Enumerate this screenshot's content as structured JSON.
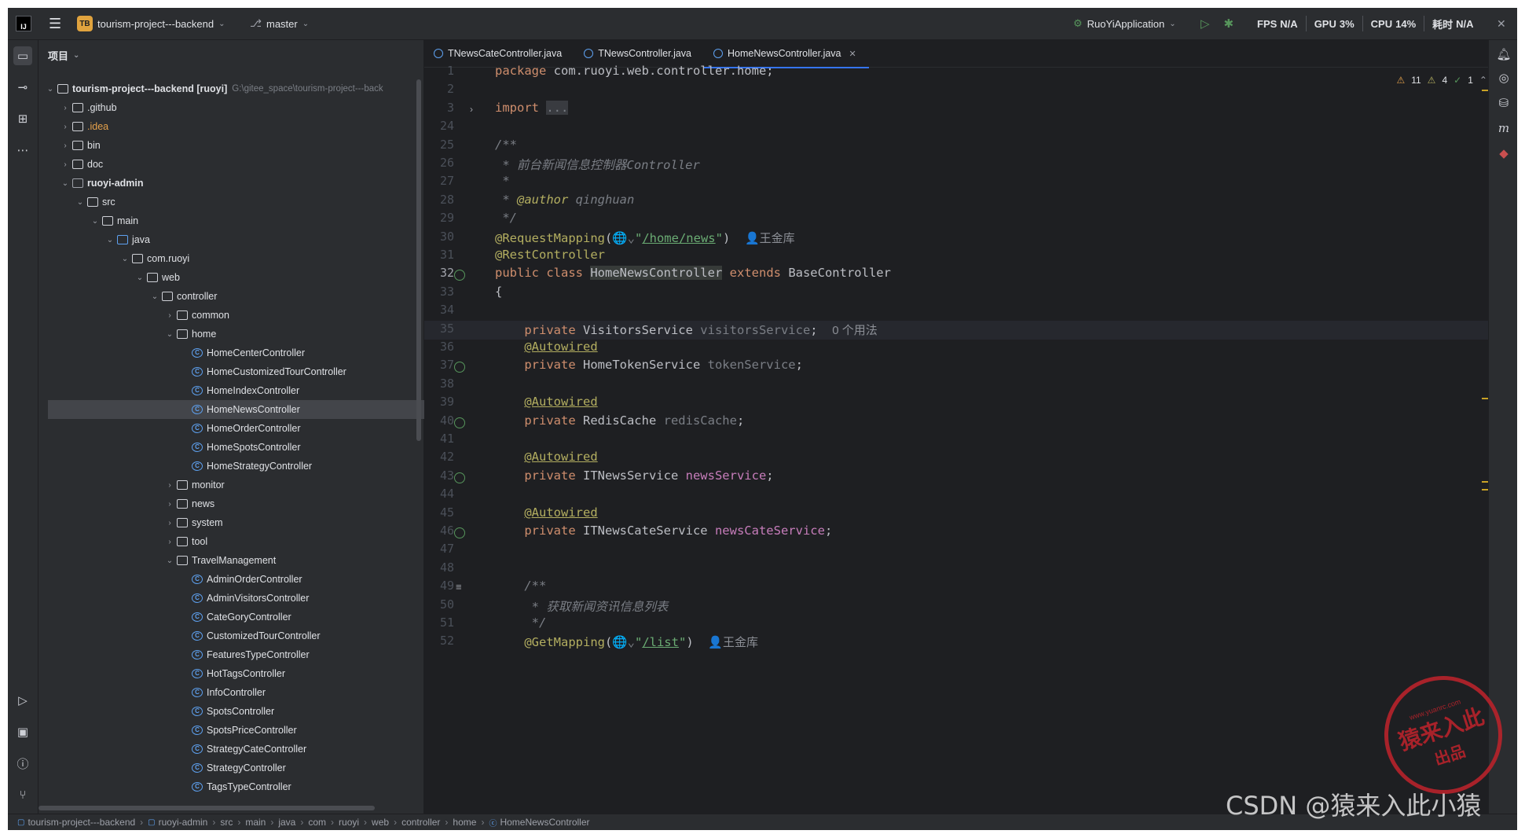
{
  "title_bar": {
    "project_badge": "TB",
    "project_name": "tourism-project---backend",
    "branch": "master",
    "run_config": "RuoYiApplication",
    "fps_label": "FPS",
    "fps_value": "N/A",
    "gpu_label": "GPU",
    "gpu_value": "3%",
    "cpu_label": "CPU",
    "cpu_value": "14%",
    "time_label": "耗时",
    "time_value": "N/A"
  },
  "project_panel": {
    "title": "项目",
    "tree": [
      {
        "label": "tourism-project---backend [ruoyi]",
        "path": "G:\\gitee_space\\tourism-project---back",
        "indent": 0,
        "arrow": "⌄",
        "icon": "folder",
        "bold": true
      },
      {
        "label": ".github",
        "indent": 1,
        "arrow": "›",
        "icon": "folder"
      },
      {
        "label": ".idea",
        "indent": 1,
        "arrow": "›",
        "icon": "folder",
        "color": "orange"
      },
      {
        "label": "bin",
        "indent": 1,
        "arrow": "›",
        "icon": "folder"
      },
      {
        "label": "doc",
        "indent": 1,
        "arrow": "›",
        "icon": "folder"
      },
      {
        "label": "ruoyi-admin",
        "indent": 1,
        "arrow": "⌄",
        "icon": "folder-mod",
        "bold": true
      },
      {
        "label": "src",
        "indent": 2,
        "arrow": "⌄",
        "icon": "folder"
      },
      {
        "label": "main",
        "indent": 3,
        "arrow": "⌄",
        "icon": "folder"
      },
      {
        "label": "java",
        "indent": 4,
        "arrow": "⌄",
        "icon": "folder-blue"
      },
      {
        "label": "com.ruoyi",
        "indent": 5,
        "arrow": "⌄",
        "icon": "package"
      },
      {
        "label": "web",
        "indent": 6,
        "arrow": "⌄",
        "icon": "package"
      },
      {
        "label": "controller",
        "indent": 7,
        "arrow": "⌄",
        "icon": "package"
      },
      {
        "label": "common",
        "indent": 8,
        "arrow": "›",
        "icon": "package"
      },
      {
        "label": "home",
        "indent": 8,
        "arrow": "⌄",
        "icon": "package"
      },
      {
        "label": "HomeCenterController",
        "indent": 9,
        "arrow": "",
        "icon": "class"
      },
      {
        "label": "HomeCustomizedTourController",
        "indent": 9,
        "arrow": "",
        "icon": "class"
      },
      {
        "label": "HomeIndexController",
        "indent": 9,
        "arrow": "",
        "icon": "class"
      },
      {
        "label": "HomeNewsController",
        "indent": 9,
        "arrow": "",
        "icon": "class",
        "selected": true
      },
      {
        "label": "HomeOrderController",
        "indent": 9,
        "arrow": "",
        "icon": "class"
      },
      {
        "label": "HomeSpotsController",
        "indent": 9,
        "arrow": "",
        "icon": "class"
      },
      {
        "label": "HomeStrategyController",
        "indent": 9,
        "arrow": "",
        "icon": "class"
      },
      {
        "label": "monitor",
        "indent": 8,
        "arrow": "›",
        "icon": "package"
      },
      {
        "label": "news",
        "indent": 8,
        "arrow": "›",
        "icon": "package"
      },
      {
        "label": "system",
        "indent": 8,
        "arrow": "›",
        "icon": "package"
      },
      {
        "label": "tool",
        "indent": 8,
        "arrow": "›",
        "icon": "package"
      },
      {
        "label": "TravelManagement",
        "indent": 8,
        "arrow": "⌄",
        "icon": "package"
      },
      {
        "label": "AdminOrderController",
        "indent": 9,
        "arrow": "",
        "icon": "class"
      },
      {
        "label": "AdminVisitorsController",
        "indent": 9,
        "arrow": "",
        "icon": "class"
      },
      {
        "label": "CateGoryController",
        "indent": 9,
        "arrow": "",
        "icon": "class"
      },
      {
        "label": "CustomizedTourController",
        "indent": 9,
        "arrow": "",
        "icon": "class"
      },
      {
        "label": "FeaturesTypeController",
        "indent": 9,
        "arrow": "",
        "icon": "class"
      },
      {
        "label": "HotTagsController",
        "indent": 9,
        "arrow": "",
        "icon": "class"
      },
      {
        "label": "InfoController",
        "indent": 9,
        "arrow": "",
        "icon": "class"
      },
      {
        "label": "SpotsController",
        "indent": 9,
        "arrow": "",
        "icon": "class"
      },
      {
        "label": "SpotsPriceController",
        "indent": 9,
        "arrow": "",
        "icon": "class"
      },
      {
        "label": "StrategyCateController",
        "indent": 9,
        "arrow": "",
        "icon": "class"
      },
      {
        "label": "StrategyController",
        "indent": 9,
        "arrow": "",
        "icon": "class"
      },
      {
        "label": "TagsTypeController",
        "indent": 9,
        "arrow": "",
        "icon": "class"
      }
    ]
  },
  "editor": {
    "tabs": [
      {
        "label": "TNewsCateController.java",
        "active": false
      },
      {
        "label": "TNewsController.java",
        "active": false
      },
      {
        "label": "HomeNewsController.java",
        "active": true
      }
    ],
    "inspections": {
      "warnings": "11",
      "weak_warnings": "4",
      "typos": "1"
    },
    "lines": [
      {
        "n": "1",
        "html": "<span class='kw'>package</span> com.ruoyi.web.controller.home;"
      },
      {
        "n": "2",
        "html": ""
      },
      {
        "n": "3",
        "html": "<span class='kw'>import</span> <span class='gray' style='background:#393b40'>...</span>",
        "fold": true
      },
      {
        "n": "24",
        "html": ""
      },
      {
        "n": "25",
        "html": "<span class='cm'>/**</span>"
      },
      {
        "n": "26",
        "html": "<span class='cm'> * 前台新闻信息控制器Controller</span>"
      },
      {
        "n": "27",
        "html": "<span class='cm'> *</span>"
      },
      {
        "n": "28",
        "html": "<span class='cm'> * <span style='color:#b3ae60;font-style:italic'>@author</span> qinghuan</span>"
      },
      {
        "n": "29",
        "html": "<span class='cm'> */</span>"
      },
      {
        "n": "30",
        "html": "<span class='an'>@RequestMapping</span>(<span class='gray'>🌐⌄</span><span class='str'>\"<u>/home/news</u>\"</span>)  <span class='inlay'>👤王金库</span>"
      },
      {
        "n": "31",
        "html": "<span class='an'>@RestController</span>"
      },
      {
        "n": "32",
        "html": "<span class='kw'>public class</span> <span style='background:#373b39'>HomeNewsController</span> <span class='kw'>extends</span> BaseController",
        "current": true,
        "gicon": true
      },
      {
        "n": "33",
        "html": "{"
      },
      {
        "n": "34",
        "html": ""
      },
      {
        "n": "35",
        "html": "    <span class='kw'>private</span> VisitorsService <span class='gray'>visitorsService</span>;  <span class='inlay'>0 个用法</span>"
      },
      {
        "n": "36",
        "html": "    <span class='an'><u>@Autowired</u></span>"
      },
      {
        "n": "37",
        "html": "    <span class='kw'>private</span> HomeTokenService <span class='gray'>tokenService</span>;",
        "gicon": true
      },
      {
        "n": "38",
        "html": ""
      },
      {
        "n": "39",
        "html": "    <span class='an'><u>@Autowired</u></span>"
      },
      {
        "n": "40",
        "html": "    <span class='kw'>private</span> RedisCache <span class='gray'>redisCache</span>;",
        "gicon": true
      },
      {
        "n": "41",
        "html": ""
      },
      {
        "n": "42",
        "html": "    <span class='an'><u>@Autowired</u></span>"
      },
      {
        "n": "43",
        "html": "    <span class='kw'>private</span> ITNewsService <span class='fld'>newsService</span>;",
        "gicon": true
      },
      {
        "n": "44",
        "html": ""
      },
      {
        "n": "45",
        "html": "    <span class='an'><u>@Autowired</u></span>"
      },
      {
        "n": "46",
        "html": "    <span class='kw'>private</span> ITNewsCateService <span class='fld'>newsCateService</span>;",
        "gicon": true
      },
      {
        "n": "47",
        "html": ""
      },
      {
        "n": "48",
        "html": ""
      },
      {
        "n": "49",
        "html": "    <span class='cm'>/**</span>",
        "doc": true
      },
      {
        "n": "50",
        "html": "    <span class='cm'> * 获取新闻资讯信息列表</span>"
      },
      {
        "n": "51",
        "html": "    <span class='cm'> */</span>"
      },
      {
        "n": "52",
        "html": "    <span class='an'>@GetMapping</span>(<span class='gray'>🌐⌄</span><span class='str'>\"<u>/list</u>\"</span>)  <span class='inlay'>👤王金库</span>"
      }
    ]
  },
  "status_bar": {
    "breadcrumbs": [
      "tourism-project---backend",
      "ruoyi-admin",
      "src",
      "main",
      "java",
      "com",
      "ruoyi",
      "web",
      "controller",
      "home",
      "HomeNewsController"
    ]
  },
  "watermark": {
    "stamp_main": "猿来入此",
    "stamp_sub": "出品",
    "stamp_url": "www.yuanrc.com",
    "csdn": "CSDN @猿来入此小猿"
  },
  "colors": {
    "accent": "#3574f0",
    "keyword": "#cf8e6d",
    "annotation": "#b3ae60",
    "string": "#6aab73",
    "stamp": "#b8232b"
  }
}
